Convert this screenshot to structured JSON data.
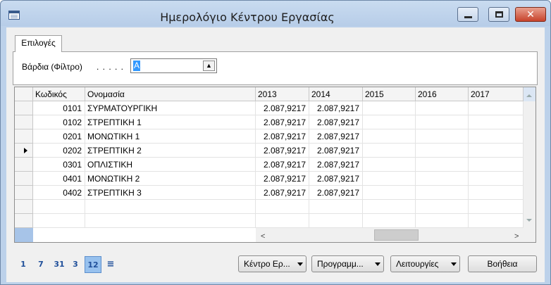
{
  "window": {
    "title": "Ημερολόγιο Κέντρου Εργασίας",
    "controls": {
      "minimize_icon": "minimize-icon",
      "maximize_icon": "maximize-icon",
      "close_glyph": "✕"
    }
  },
  "tabs": [
    {
      "label": "Επιλογές",
      "selected": true
    }
  ],
  "filter": {
    "label": "Βάρδια (Φίλτρο)",
    "dots": ". . . . .",
    "value": "A",
    "button_glyph": "▲"
  },
  "grid": {
    "columns": [
      "",
      "Κωδικός",
      "Ονομασία",
      "2013",
      "2014",
      "2015",
      "2016",
      "2017"
    ],
    "rows": [
      {
        "code": "0101",
        "name": "ΣΥΡΜΑΤΟΥΡΓΙΚΗ",
        "y2013": "2.087,9217",
        "y2014": "2.087,9217",
        "y2015": "",
        "y2016": "",
        "y2017": "",
        "current": false
      },
      {
        "code": "0102",
        "name": "ΣΤΡΕΠΤΙΚΗ 1",
        "y2013": "2.087,9217",
        "y2014": "2.087,9217",
        "y2015": "",
        "y2016": "",
        "y2017": "",
        "current": false
      },
      {
        "code": "0201",
        "name": "ΜΟΝΩΤΙΚΗ 1",
        "y2013": "2.087,9217",
        "y2014": "2.087,9217",
        "y2015": "",
        "y2016": "",
        "y2017": "",
        "current": false
      },
      {
        "code": "0202",
        "name": "ΣΤΡΕΠΤΙΚΗ 2",
        "y2013": "2.087,9217",
        "y2014": "2.087,9217",
        "y2015": "",
        "y2016": "",
        "y2017": "",
        "current": true
      },
      {
        "code": "0301",
        "name": "ΟΠΛΙΣΤΙΚΗ",
        "y2013": "2.087,9217",
        "y2014": "2.087,9217",
        "y2015": "",
        "y2016": "",
        "y2017": "",
        "current": false
      },
      {
        "code": "0401",
        "name": "ΜΟΝΩΤΙΚΗ 2",
        "y2013": "2.087,9217",
        "y2014": "2.087,9217",
        "y2015": "",
        "y2016": "",
        "y2017": "",
        "current": false
      },
      {
        "code": "0402",
        "name": "ΣΤΡΕΠΤΙΚΗ 3",
        "y2013": "2.087,9217",
        "y2014": "2.087,9217",
        "y2015": "",
        "y2016": "",
        "y2017": "",
        "current": false
      }
    ],
    "empty_rows": 2,
    "scroll": {
      "left_glyph": "<",
      "right_glyph": ">"
    }
  },
  "pager": {
    "items": [
      {
        "label": "1",
        "active": false
      },
      {
        "label": "7",
        "active": false
      },
      {
        "label": "31",
        "active": false
      },
      {
        "label": "3",
        "active": false
      },
      {
        "label": "12",
        "active": true
      }
    ],
    "menu_glyph": "≡"
  },
  "buttons": {
    "work_center": "Κέντρο Ερ...",
    "programs": "Προγραμμ...",
    "functions": "Λειτουργίες",
    "help": "Βοήθεια"
  },
  "colors": {
    "frame": "#bcd1ea",
    "selection": "#3399ff",
    "pager_active": "#97c1ee",
    "close_button": "#c7432b"
  }
}
